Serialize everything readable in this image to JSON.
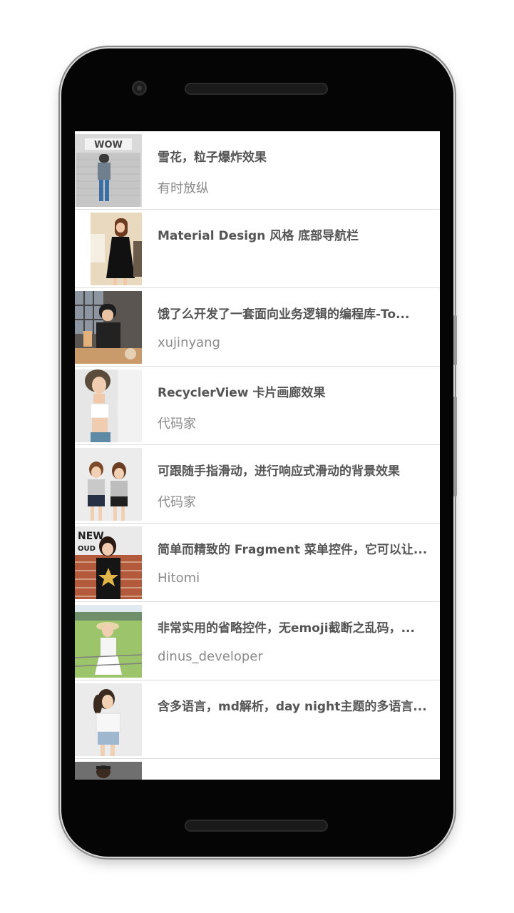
{
  "list": {
    "items": [
      {
        "title": "雪花，粒子爆炸效果",
        "author": "有时放纵",
        "thumb_icon": "photo-storefront-girl"
      },
      {
        "title": "Material Design 风格 底部导航栏",
        "author": "",
        "thumb_icon": "photo-girl-black-dress"
      },
      {
        "title": "饿了么开发了一套面向业务逻辑的编程库-To...",
        "author": "xujinyang",
        "thumb_icon": "photo-girl-cafe"
      },
      {
        "title": "RecyclerView 卡片画廊效果",
        "author": "代码家",
        "thumb_icon": "photo-girl-white-top"
      },
      {
        "title": "可跟随手指滑动，进行响应式滑动的背景效果",
        "author": "代码家",
        "thumb_icon": "photo-two-girls"
      },
      {
        "title": "简单而精致的 Fragment 菜单控件，它可以让...",
        "author": "Hitomi",
        "thumb_icon": "photo-girl-brick-wall"
      },
      {
        "title": "非常实用的省略控件，无emoji截断之乱码，...",
        "author": "dinus_developer",
        "thumb_icon": "photo-girl-field"
      },
      {
        "title": "含多语言，md解析，day night主题的多语言...",
        "author": "",
        "thumb_icon": "photo-girl-ponytail"
      }
    ]
  },
  "colors": {
    "phone_body": "#050505",
    "title_text": "#555555",
    "author_text": "#8a8a8a",
    "divider": "#dcdcdc"
  }
}
